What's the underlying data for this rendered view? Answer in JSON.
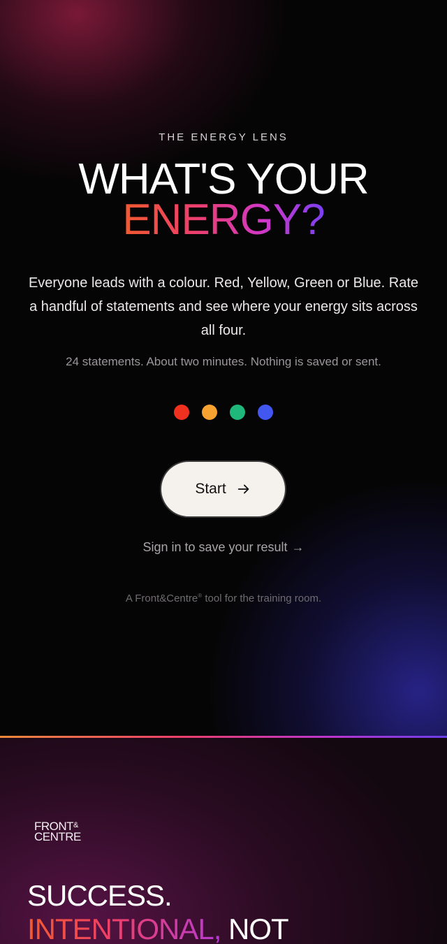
{
  "hero": {
    "kicker": "THE ENERGY LENS",
    "headline_line1": "WHAT'S YOUR",
    "headline_line2": "ENERGY?",
    "intro": "Everyone leads with a colour. Red, Yellow, Green or Blue. Rate a handful of statements and see where your energy sits across all four.",
    "note": "24 statements. About two minutes. Nothing is saved or sent.",
    "dots": [
      {
        "name": "red-dot",
        "color": "#f0311f"
      },
      {
        "name": "yellow-dot",
        "color": "#f7a130"
      },
      {
        "name": "green-dot",
        "color": "#1fb87a"
      },
      {
        "name": "blue-dot",
        "color": "#4257f0"
      }
    ],
    "start_label": "Start",
    "start_icon": "arrow-right-icon",
    "signin_label": "Sign in to save your result",
    "signin_arrow": "→",
    "credit_prefix": "A Front&Centre",
    "credit_reg": "®",
    "credit_suffix": " tool for the training room."
  },
  "footer": {
    "logo_line1": "FRONT",
    "logo_amp": "&",
    "logo_line2": "CENTRE",
    "tagline_line1": "SUCCESS.",
    "tagline_line2_accent": "INTENTIONAL,",
    "tagline_line2_rest": " NOT"
  },
  "colors": {
    "accent_start": "#f25a2e",
    "accent_mid": "#ee3f6a",
    "accent_end": "#7b3ff0",
    "button_bg": "#f5f1ec"
  }
}
